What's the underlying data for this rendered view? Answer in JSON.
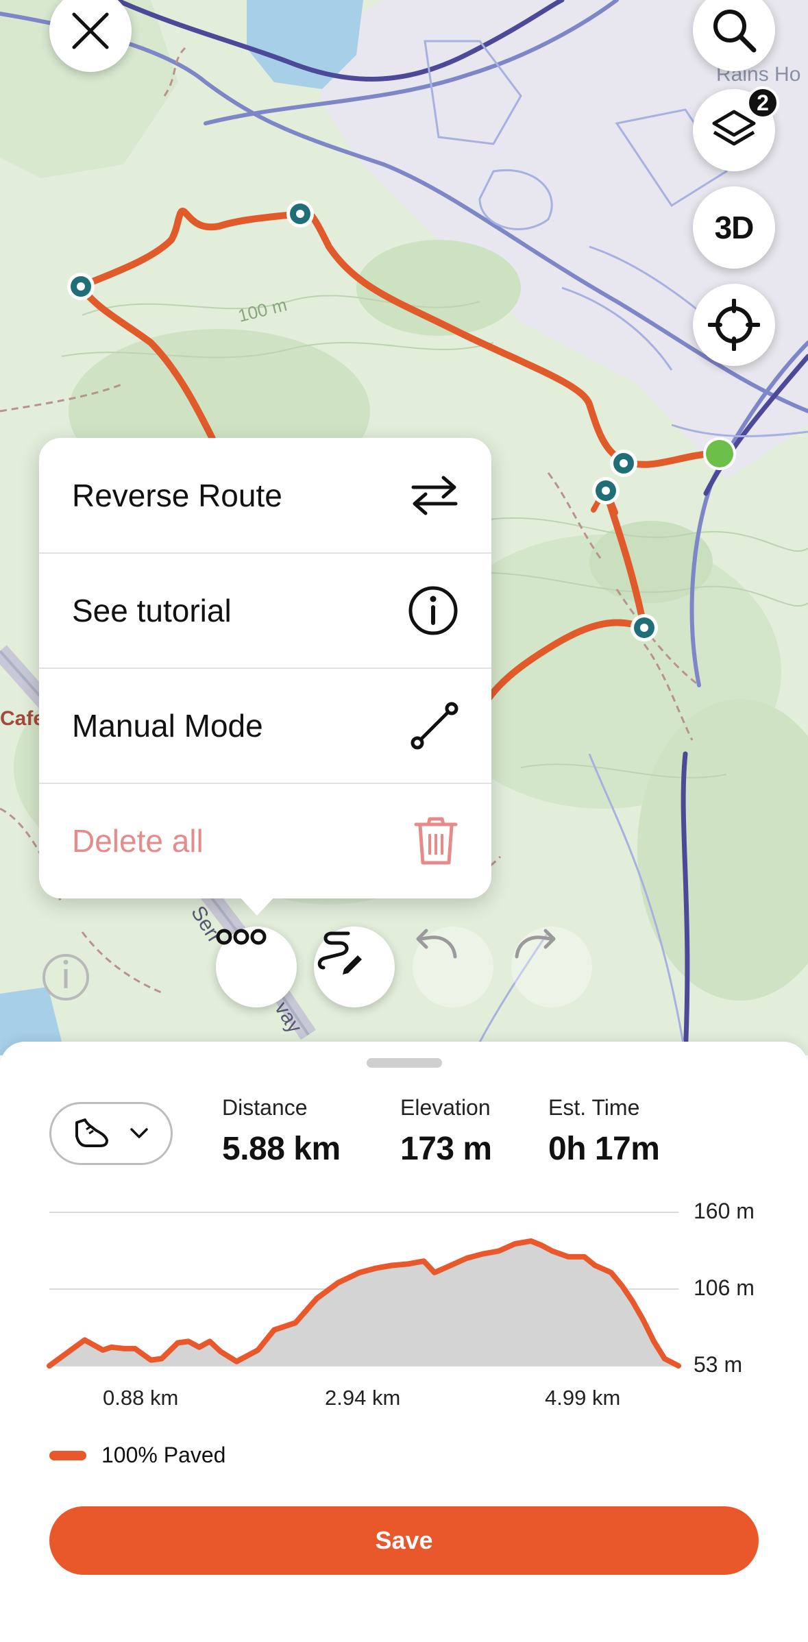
{
  "map": {
    "contour_label": "100 m",
    "place_label": "Rains Ho",
    "road_label_1": "Serr",
    "road_label_2": "vay",
    "poi_label": "Cafe",
    "layers_badge": "2",
    "btn_3d_label": "3D"
  },
  "menu": {
    "items": [
      {
        "label": "Reverse Route",
        "icon": "swap-arrows-icon"
      },
      {
        "label": "See tutorial",
        "icon": "info-circle-icon"
      },
      {
        "label": "Manual Mode",
        "icon": "line-segment-icon"
      },
      {
        "label": "Delete all",
        "icon": "trash-icon",
        "color": "#e68a8a"
      }
    ]
  },
  "toolbar": {
    "more_icon": "more-dots-icon",
    "draw_icon": "route-draw-icon",
    "undo_icon": "undo-icon",
    "redo_icon": "redo-icon"
  },
  "stats": {
    "distance_label": "Distance",
    "distance_value": "5.88 km",
    "elevation_label": "Elevation",
    "elevation_value": "173 m",
    "time_label": "Est. Time",
    "time_value": "0h 17m",
    "sport_icon": "shoe-icon"
  },
  "chart_data": {
    "type": "area",
    "title": "",
    "xlabel": "",
    "ylabel": "",
    "x_ticks": [
      "0.88 km",
      "2.94 km",
      "4.99 km"
    ],
    "y_ticks": [
      "160 m",
      "106 m",
      "53 m"
    ],
    "ylim": [
      53,
      160
    ],
    "xlim": [
      0,
      5.88
    ],
    "series": [
      {
        "name": "100% Paved",
        "color": "#e8582b",
        "x": [
          0,
          0.33,
          0.5,
          0.58,
          0.7,
          0.8,
          0.95,
          1.05,
          1.2,
          1.3,
          1.4,
          1.5,
          1.6,
          1.75,
          1.95,
          2.1,
          2.3,
          2.5,
          2.7,
          2.9,
          3.05,
          3.2,
          3.35,
          3.5,
          3.6,
          3.75,
          3.9,
          4.05,
          4.2,
          4.35,
          4.5,
          4.6,
          4.7,
          4.85,
          5.0,
          5.1,
          5.25,
          5.35,
          5.45,
          5.55,
          5.65,
          5.75,
          5.88
        ],
        "y": [
          53,
          71,
          64,
          66,
          65,
          65,
          57,
          58,
          69,
          70,
          66,
          70,
          63,
          56,
          64,
          78,
          83,
          100,
          111,
          118,
          121,
          123,
          124,
          126,
          118,
          123,
          128,
          131,
          133,
          138,
          140,
          137,
          133,
          129,
          129,
          123,
          118,
          109,
          98,
          85,
          70,
          58,
          53
        ]
      }
    ],
    "legend_position": "bottom-left"
  },
  "legend": {
    "label": "100% Paved"
  },
  "save_label": "Save",
  "colors": {
    "accent": "#e8582b",
    "route": "#e05a2a",
    "waypoint": "#1f6e78",
    "start": "#6cc04a"
  }
}
